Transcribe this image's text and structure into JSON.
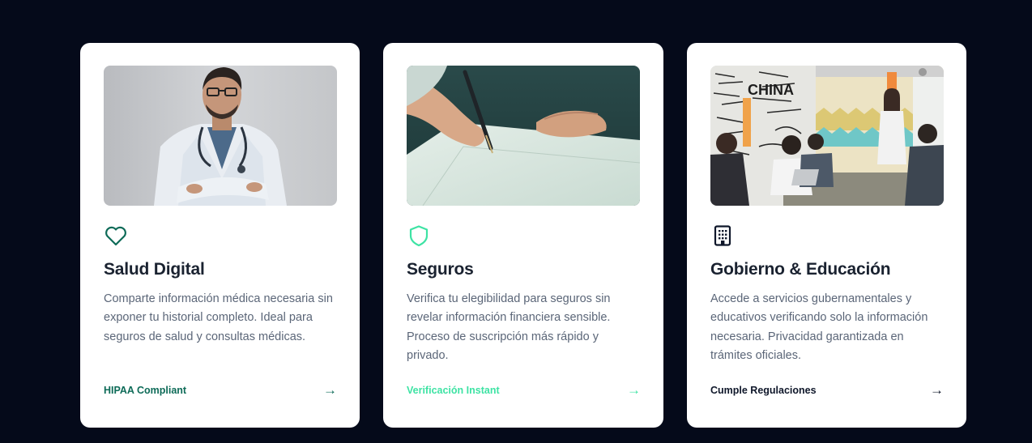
{
  "cards": [
    {
      "title": "Salud Digital",
      "description": "Comparte información médica necesaria sin exponer tu historial completo. Ideal para seguros de salud y consultas médicas.",
      "tag": "HIPAA Compliant",
      "arrow": "→",
      "icon": "heart-icon",
      "accent": "#0e6b58"
    },
    {
      "title": "Seguros",
      "description": "Verifica tu elegibilidad para seguros sin revelar información financiera sensible. Proceso de suscripción más rápido y privado.",
      "tag": "Verificación Instant",
      "arrow": "→",
      "icon": "shield-icon",
      "accent": "#3ee3a4"
    },
    {
      "title": "Gobierno & Educación",
      "description": "Accede a servicios gubernamentales y educativos verificando solo la información necesaria. Privacidad garantizada en trámites oficiales.",
      "tag": "Cumple Regulaciones",
      "arrow": "→",
      "icon": "building-icon",
      "accent": "#0f172a"
    }
  ]
}
